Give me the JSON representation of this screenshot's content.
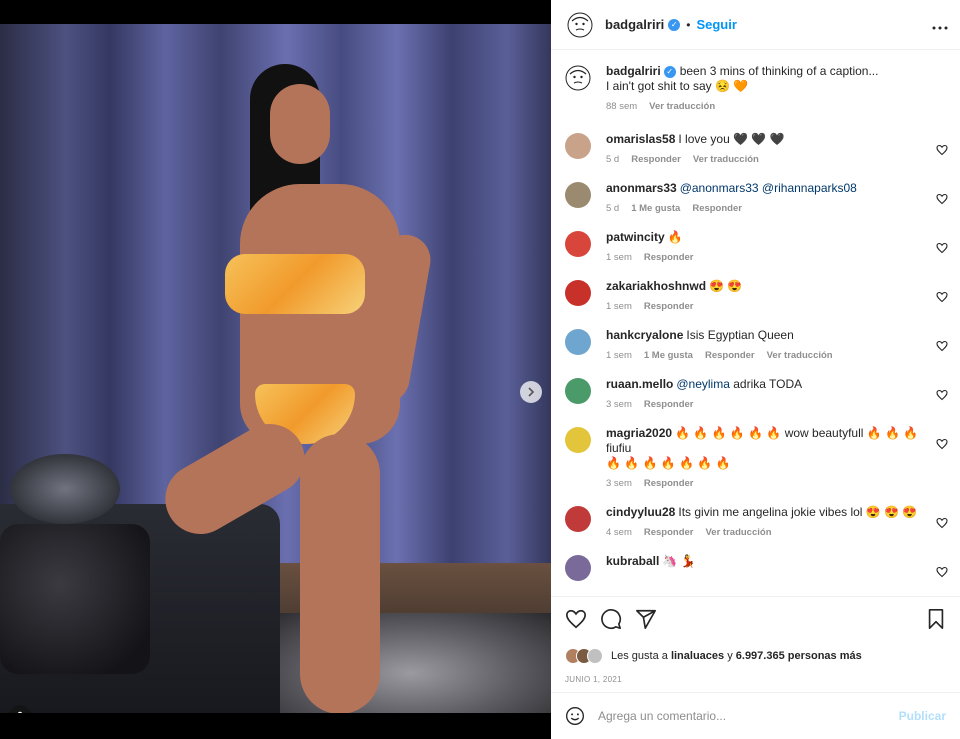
{
  "post": {
    "username": "badgalriri",
    "separator": "•",
    "follow_label": "Seguir",
    "more_label": "•••",
    "caption_line1": "been 3 mins of thinking of a caption...",
    "caption_line2": "I ain't got shit to say 😣 🧡",
    "caption_time": "88 sem",
    "caption_translate": "Ver traducción",
    "date": "JUNIO 1, 2021",
    "photo_count": 2,
    "current_photo": 1
  },
  "comments": [
    {
      "user": "omarislas58",
      "text": "I love you 🖤 🖤 🖤",
      "mention": "",
      "time": "5 d",
      "likes": "",
      "reply": "Responder",
      "translate": "Ver traducción",
      "avatar_color": "#c9a28a"
    },
    {
      "user": "anonmars33",
      "text": "",
      "mention": "@anonmars33 @rihannaparks08",
      "time": "5 d",
      "likes": "1 Me gusta",
      "reply": "Responder",
      "translate": "",
      "avatar_color": "#9a8a70"
    },
    {
      "user": "patwincity",
      "text": "🔥",
      "mention": "",
      "time": "1 sem",
      "likes": "",
      "reply": "Responder",
      "translate": "",
      "avatar_color": "#d8453a"
    },
    {
      "user": "zakariakhoshnwd",
      "text": "😍 😍",
      "mention": "",
      "time": "1 sem",
      "likes": "",
      "reply": "Responder",
      "translate": "",
      "avatar_color": "#c8302a"
    },
    {
      "user": "hankcryalone",
      "text": "Isis Egyptian Queen",
      "mention": "",
      "time": "1 sem",
      "likes": "1 Me gusta",
      "reply": "Responder",
      "translate": "Ver traducción",
      "avatar_color": "#6fa6d0"
    },
    {
      "user": "ruaan.mello",
      "text": "adrika TODA",
      "mention": "@neylima",
      "time": "3 sem",
      "likes": "",
      "reply": "Responder",
      "translate": "",
      "avatar_color": "#4a9a6a"
    },
    {
      "user": "magria2020",
      "text": "🔥 🔥 🔥 🔥 🔥 🔥 wow beautyfull 🔥 🔥 🔥 fiufiu",
      "text2": "🔥 🔥 🔥 🔥 🔥 🔥 🔥",
      "mention": "",
      "time": "3 sem",
      "likes": "",
      "reply": "Responder",
      "translate": "",
      "avatar_color": "#e2c53a"
    },
    {
      "user": "cindyyluu28",
      "text": "Its givin me angelina jokie vibes lol 😍 😍 😍",
      "mention": "",
      "time": "4 sem",
      "likes": "",
      "reply": "Responder",
      "translate": "Ver traducción",
      "avatar_color": "#c03a3a"
    },
    {
      "user": "kubraball",
      "text": "🦄 💃",
      "mention": "",
      "time": "",
      "likes": "",
      "reply": "",
      "translate": "",
      "avatar_color": "#7a6a9a"
    }
  ],
  "likes": {
    "prefix": "Les gusta a",
    "user": "linaluaces",
    "conj": "y",
    "count": "6.997.365 personas más"
  },
  "comment_box": {
    "placeholder": "Agrega un comentario...",
    "publish_label": "Publicar"
  },
  "colors": {
    "link_blue": "#0095f6",
    "publish_disabled": "#b2dffc",
    "verified": "#3897f0"
  }
}
